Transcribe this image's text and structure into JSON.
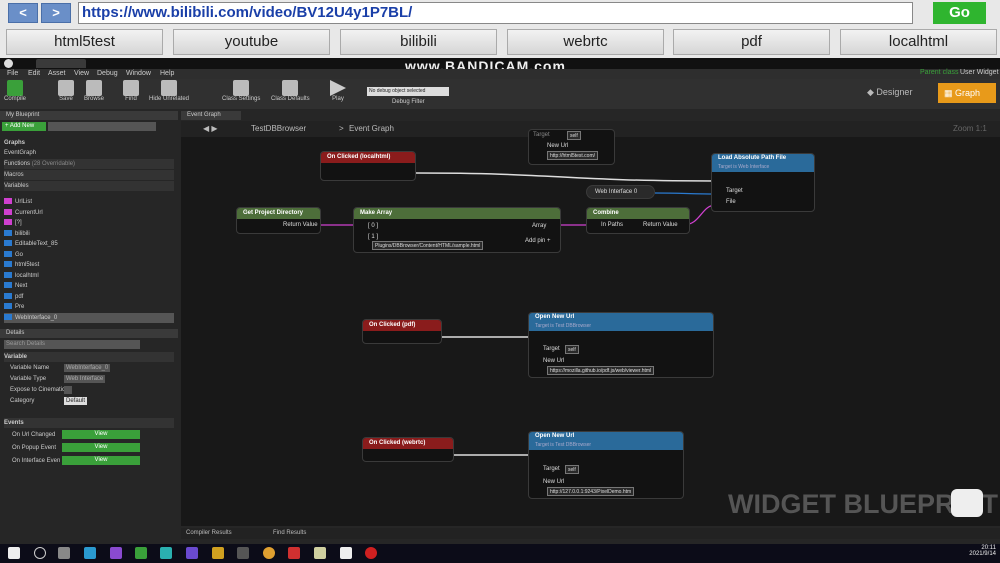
{
  "browser": {
    "back": "<",
    "forward": ">",
    "url": "https://www.bilibili.com/video/BV12U4y1P7BL/",
    "go": "Go",
    "bookmarks": [
      "html5test",
      "youtube",
      "bilibili",
      "webrtc",
      "pdf",
      "localhtml"
    ]
  },
  "watermark": "www.BANDICAM.com",
  "ue": {
    "menu": [
      "File",
      "Edit",
      "Asset",
      "View",
      "Debug",
      "Window",
      "Help"
    ],
    "toolbar": [
      "Compile",
      "Save",
      "Browse",
      "Find",
      "Hide Unrelated",
      "Class Settings",
      "Class Defaults",
      "Play"
    ],
    "debug_select": "No debug object selected",
    "debug_label": "Debug Filter",
    "designer": "Designer",
    "graph_mode": "Graph",
    "parent_class": "Parent class",
    "parent_class_value": "User Widget",
    "my_blueprint": "My Blueprint",
    "add_new": "+ Add New",
    "sections": {
      "graphs": "Graphs",
      "event_graph": "EventGraph",
      "functions": "Functions",
      "functions_note": "(28 Overridable)",
      "macros": "Macros",
      "variables": "Variables"
    },
    "variables": [
      {
        "name": "UrlList",
        "color": "#d040d0"
      },
      {
        "name": "CurrentUrl",
        "color": "#d040d0"
      },
      {
        "name": "[?]",
        "color": "#d040d0"
      },
      {
        "name": "bilibili",
        "color": "#2a7ad0"
      },
      {
        "name": "EditableText_85",
        "color": "#2a7ad0"
      },
      {
        "name": "Go",
        "color": "#2a7ad0"
      },
      {
        "name": "html5test",
        "color": "#2a7ad0"
      },
      {
        "name": "localhtml",
        "color": "#2a7ad0"
      },
      {
        "name": "Next",
        "color": "#2a7ad0"
      },
      {
        "name": "pdf",
        "color": "#2a7ad0"
      },
      {
        "name": "Pre",
        "color": "#2a7ad0"
      },
      {
        "name": "WebInterface_0",
        "color": "#2a7ad0"
      }
    ],
    "details": {
      "title": "Details",
      "search": "Search Details",
      "variable_header": "Variable",
      "rows": [
        {
          "label": "Variable Name",
          "value": "WebInterface_0"
        },
        {
          "label": "Variable Type",
          "value": "Web Interface"
        },
        {
          "label": "Expose to Cinematics",
          "value": ""
        },
        {
          "label": "Category",
          "value": "Default"
        }
      ],
      "events_header": "Events",
      "events": [
        {
          "label": "On Url Changed",
          "button": "View"
        },
        {
          "label": "On Popup Event",
          "button": "View"
        },
        {
          "label": "On Interface Event",
          "button": "View"
        }
      ]
    },
    "graph": {
      "tab": "Event Graph",
      "breadcrumb_root": "TestDBBrowser",
      "breadcrumb_sep": ">",
      "breadcrumb_leaf": "Event Graph",
      "zoom": "Zoom 1:1",
      "brand": "WIDGET BLUEPRINT",
      "nodes": {
        "on_localhtml": "On Clicked (localhtml)",
        "load_abs": "Load Absolute Path File",
        "load_abs_sub": "Target is Web Interface",
        "web_interface": "Web Interface 0",
        "get_proj": "Get Project Directory",
        "return_value": "Return Value",
        "make_array": "Make Array",
        "idx0": "[ 0 ]",
        "idx1": "[ 1 ]",
        "array": "Array",
        "add_pin": "Add pin +",
        "sample_path": "Plugins/DBBrowser/Content/HTML/sample.html",
        "combine": "Combine",
        "in_paths": "In Paths",
        "target": "Target",
        "file": "File",
        "top_self": "self",
        "top_url": "http://html5test.com/",
        "new_url": "New Url",
        "on_pdf": "On Clicked (pdf)",
        "open_url": "Open New Url",
        "open_sub": "Target is Test DBBrowser",
        "self": "self",
        "pdf_url": "https://mozilla.github.io/pdf.js/web/viewer.html",
        "on_webrtc": "On Clicked (webrtc)",
        "webrtc_url": "http://127.0.0.1:9243/PixelDemo.htm"
      },
      "bottom_tabs": [
        "Compiler Results",
        "Find Results"
      ]
    }
  },
  "taskbar": {
    "time": "20:11",
    "date": "2021/9/14"
  }
}
